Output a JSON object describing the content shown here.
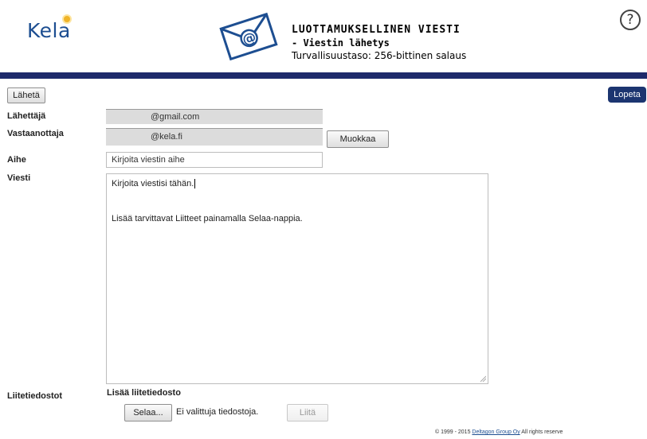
{
  "header": {
    "logo_text": "Kela",
    "title": "LUOTTAMUKSELLINEN VIESTI",
    "subtitle": "- Viestin lähetys",
    "security": "Turvallisuustaso: 256-bittinen salaus",
    "help_symbol": "?",
    "icons": {
      "envelope": "envelope-at-icon",
      "help": "help-circle-icon"
    }
  },
  "toolbar": {
    "send_label": "Lähetä",
    "quit_label": "Lopeta"
  },
  "form": {
    "sender_label": "Lähettäjä",
    "sender_value": "@gmail.com",
    "recipient_label": "Vastaanottaja",
    "recipient_value": "@kela.fi",
    "edit_label": "Muokkaa",
    "subject_label": "Aihe",
    "subject_value": "Kirjoita viestin aihe",
    "message_label": "Viesti",
    "message_line1": "Kirjoita viestisi tähän.",
    "message_line2": "Lisää tarvittavat Liitteet painamalla Selaa-nappia."
  },
  "attachments": {
    "label": "Liitetiedostot",
    "add_label": "Lisää liitetiedosto",
    "browse_label": "Selaa...",
    "no_files": "Ei valittuja tiedostoja.",
    "attach_label": "Liitä"
  },
  "footer": {
    "copyright": "© 1999 - 2015",
    "company": "Deltagon Group Oy",
    "rights": "All rights reserve"
  },
  "colors": {
    "brand_blue": "#1d4e91",
    "bar_navy": "#1e2a6b",
    "logo_accent": "#f0b429"
  }
}
